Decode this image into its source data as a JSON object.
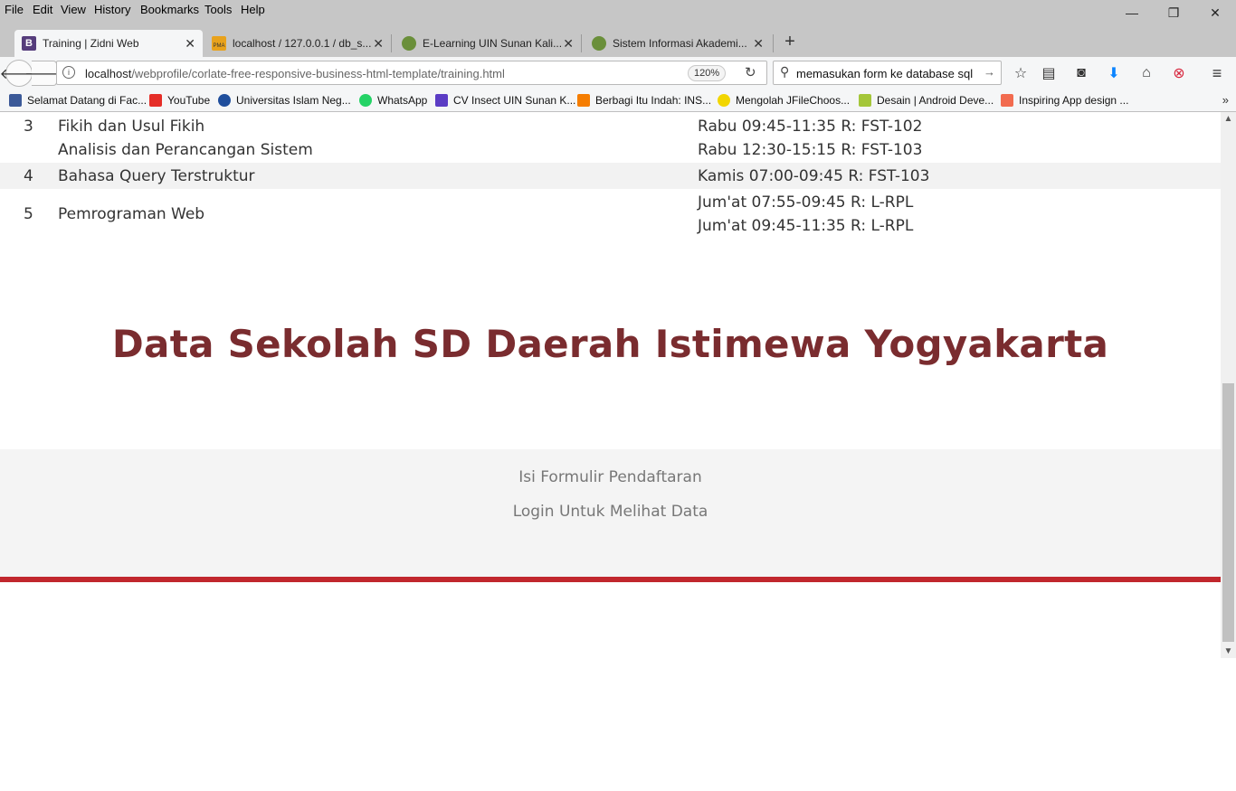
{
  "menu": [
    "File",
    "Edit",
    "View",
    "History",
    "Bookmarks",
    "Tools",
    "Help"
  ],
  "window_controls": {
    "minimize": "—",
    "restore": "❐",
    "close": "✕"
  },
  "tabs": [
    {
      "title": "Training | Zidni Web",
      "favicon_color": "#563d7c",
      "favicon_glyph": "B"
    },
    {
      "title": "localhost / 127.0.0.1 / db_s...",
      "favicon_color": "#e8a21c",
      "favicon_glyph": "PMA"
    },
    {
      "title": "E-Learning UIN Sunan Kali...",
      "favicon_color": "#6a8f3a",
      "favicon_glyph": ""
    },
    {
      "title": "Sistem Informasi Akademi...",
      "favicon_color": "#6a8f3a",
      "favicon_glyph": ""
    }
  ],
  "new_tab": "+",
  "url": {
    "host": "localhost",
    "path": "/webprofile/corlate-free-responsive-business-html-template/training.html"
  },
  "zoom": "120%",
  "search": {
    "value": "memasukan form ke database sql"
  },
  "bookmarks": [
    {
      "label": "Selamat Datang di Fac...",
      "color": "#3b5998"
    },
    {
      "label": "YouTube",
      "color": "#e52d27"
    },
    {
      "label": "Universitas Islam Neg...",
      "color": "#1f4e9c"
    },
    {
      "label": "WhatsApp",
      "color": "#25d366"
    },
    {
      "label": "CV Insect UIN Sunan K...",
      "color": "#5b3cc4"
    },
    {
      "label": "Berbagi Itu Indah: INS...",
      "color": "#f57d00"
    },
    {
      "label": "Mengolah JFileChoos...",
      "color": "#f2d600"
    },
    {
      "label": "Desain | Android Deve...",
      "color": "#a4c639"
    },
    {
      "label": "Inspiring App design ...",
      "color": "#f26b4f"
    }
  ],
  "schedule": [
    {
      "no": "3",
      "subjects": [
        "Fikih dan Usul Fikih",
        "Analisis dan Perancangan Sistem"
      ],
      "times": [
        "Rabu 09:45-11:35 R: FST-102",
        "Rabu 12:30-15:15 R: FST-103"
      ]
    },
    {
      "no": "4",
      "subjects": [
        "Bahasa Query Terstruktur"
      ],
      "times": [
        "Kamis 07:00-09:45 R: FST-103"
      ]
    },
    {
      "no": "5",
      "subjects": [
        "Pemrograman Web"
      ],
      "times": [
        "Jum'at 07:55-09:45 R: L-RPL",
        "Jum'at 09:45-11:35 R: L-RPL"
      ]
    }
  ],
  "hero_title": "Data Sekolah SD Daerah Istimewa Yogyakarta",
  "footer": {
    "link1": "Isi Formulir Pendaftaran",
    "link2": "Login Untuk Melihat Data"
  },
  "colors": {
    "hero": "#7a2c2f",
    "accent_line": "#c1272d",
    "footer_bg": "#f4f4f4"
  }
}
